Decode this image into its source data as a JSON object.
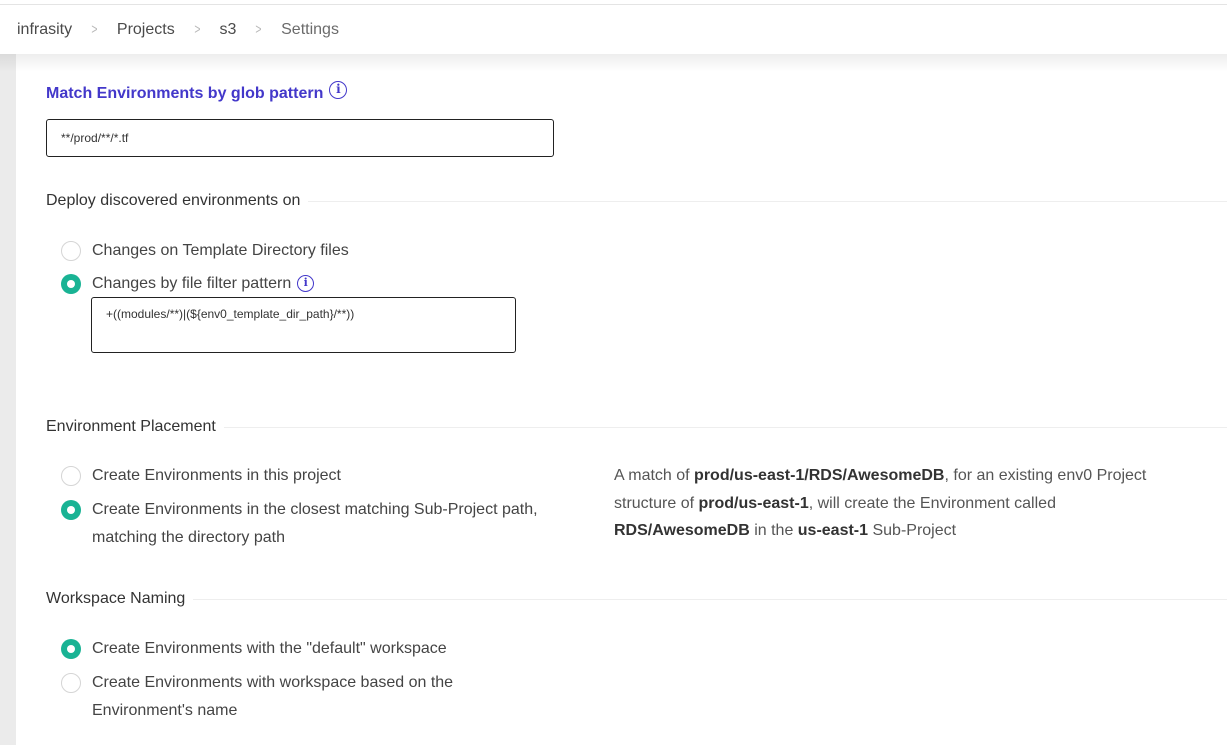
{
  "breadcrumb": {
    "items": [
      "infrasity",
      "Projects",
      "s3",
      "Settings"
    ],
    "separator": ">"
  },
  "glob": {
    "title": "Match Environments by glob pattern",
    "value": "**/prod/**/*.tf"
  },
  "deploy": {
    "title": "Deploy discovered environments on",
    "options": [
      "Changes on Template Directory files",
      "Changes by file filter pattern"
    ],
    "selected": 1,
    "filter_value": "+((modules/**)|(${env0_template_dir_path}/**))"
  },
  "placement": {
    "title": "Environment Placement",
    "options": [
      "Create Environments in this project",
      "Create Environments in the closest matching Sub-Project path, matching the directory path"
    ],
    "selected": 1,
    "example": {
      "t1": "A match of ",
      "b1": "prod/us-east-1/RDS/AwesomeDB",
      "t2": ", for an existing env0 Project structure of ",
      "b2": "prod/us-east-1",
      "t3": ", will create the Environment called ",
      "b3": "RDS/AwesomeDB",
      "t4": " in the ",
      "b4": "us-east-1",
      "t5": " Sub-Project"
    }
  },
  "workspace": {
    "title": "Workspace Naming",
    "options": [
      "Create Environments with the \"default\" workspace",
      "Create Environments with workspace based on the Environment's name"
    ],
    "selected": 0
  },
  "colors": {
    "accent": "#4338ca",
    "radio_selected": "#19b394"
  }
}
